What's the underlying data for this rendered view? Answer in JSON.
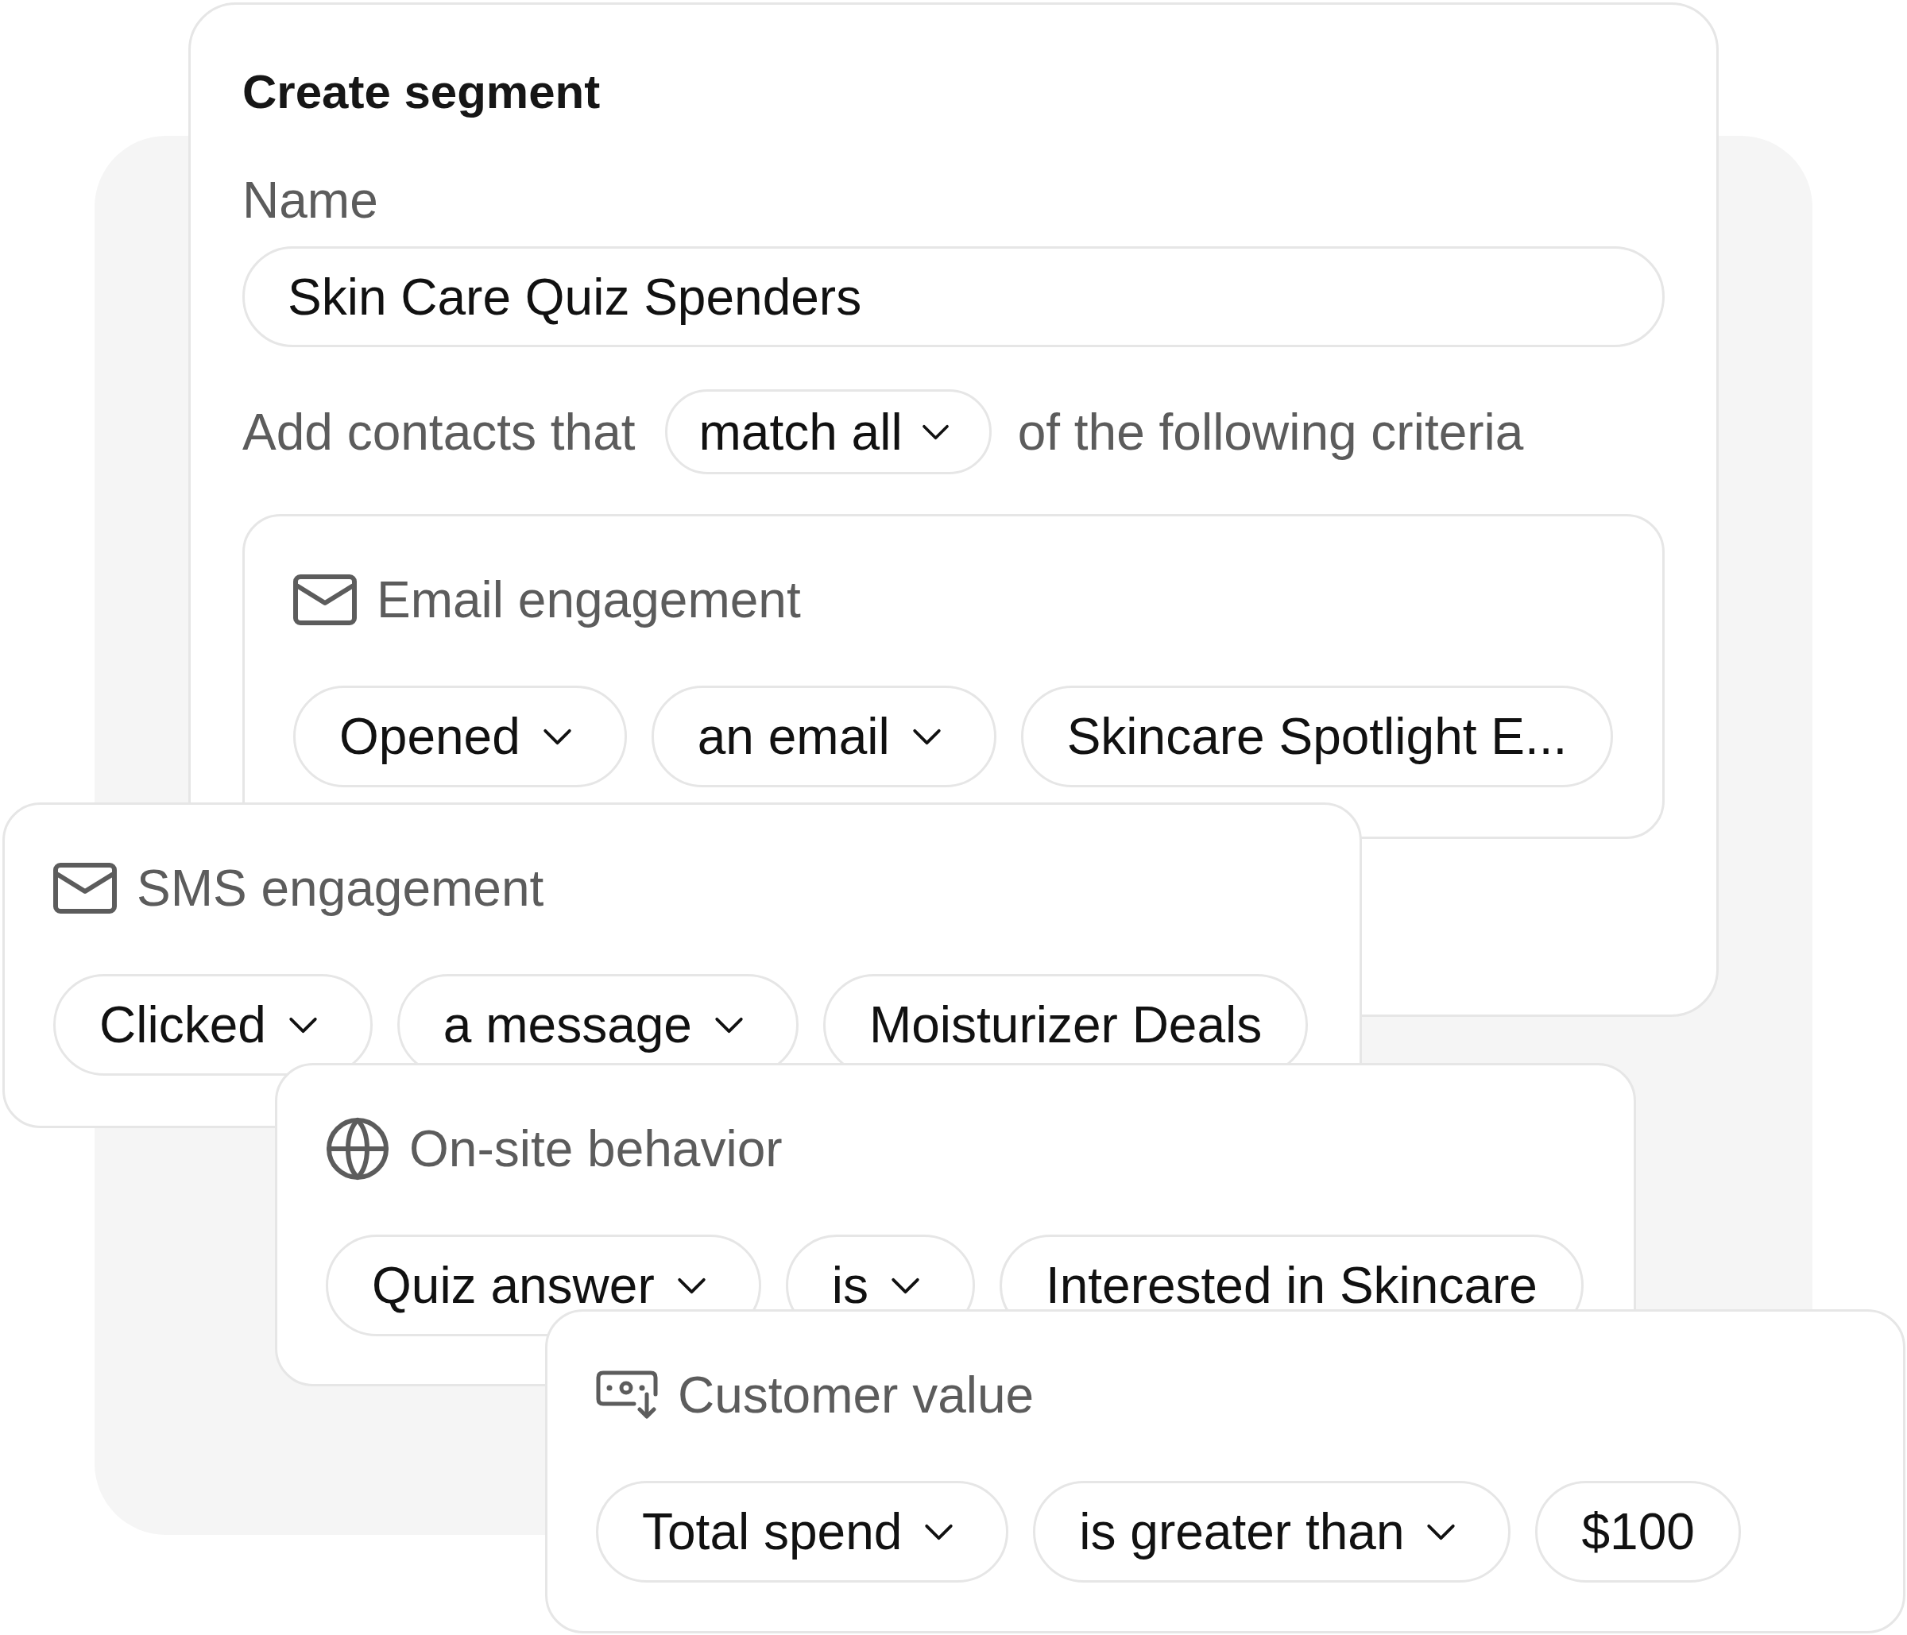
{
  "segment_form": {
    "title": "Create segment",
    "name_label": "Name",
    "name_value": "Skin Care Quiz Spenders",
    "match_prefix": "Add contacts that",
    "match_option": "match all",
    "match_suffix": "of the following criteria"
  },
  "criteria": [
    {
      "kind": "email",
      "title": "Email engagement",
      "conditions": [
        {
          "kind": "dropdown",
          "text": "Opened"
        },
        {
          "kind": "dropdown",
          "text": "an email"
        },
        {
          "kind": "value",
          "text": "Skincare Spotlight E..."
        }
      ]
    },
    {
      "kind": "sms",
      "title": "SMS engagement",
      "conditions": [
        {
          "kind": "dropdown",
          "text": "Clicked"
        },
        {
          "kind": "dropdown",
          "text": "a message"
        },
        {
          "kind": "value",
          "text": "Moisturizer Deals"
        }
      ]
    },
    {
      "kind": "site",
      "title": "On-site behavior",
      "conditions": [
        {
          "kind": "dropdown",
          "text": "Quiz answer"
        },
        {
          "kind": "dropdown",
          "text": "is"
        },
        {
          "kind": "value",
          "text": "Interested in Skincare"
        }
      ]
    },
    {
      "kind": "value",
      "title": "Customer value",
      "conditions": [
        {
          "kind": "dropdown",
          "text": "Total spend"
        },
        {
          "kind": "dropdown",
          "text": "is greater than"
        },
        {
          "kind": "value",
          "text": "$100"
        }
      ]
    }
  ]
}
